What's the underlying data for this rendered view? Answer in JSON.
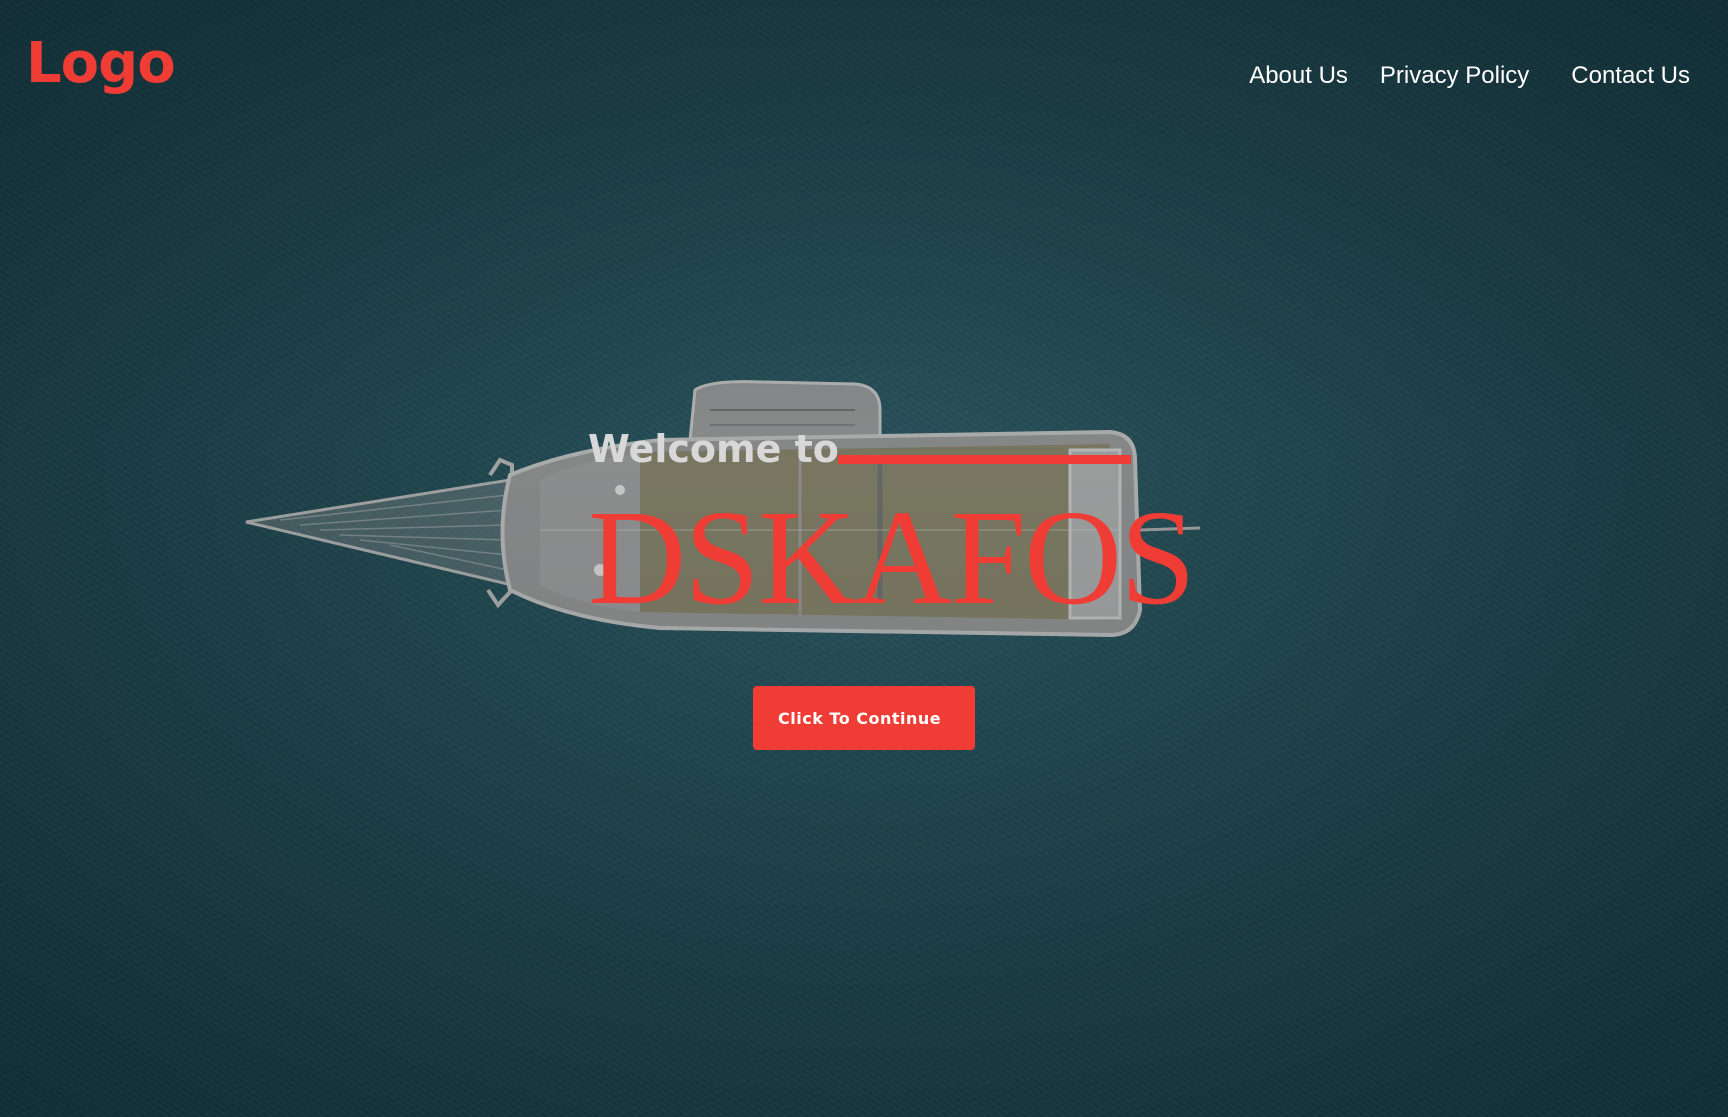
{
  "header": {
    "logo_text": "Logo",
    "nav": [
      {
        "label": "About Us"
      },
      {
        "label": "Privacy Policy"
      },
      {
        "label": "Contact Us"
      }
    ]
  },
  "hero": {
    "welcome_text": "Welcome to",
    "brand_name": "DSKAFOS",
    "cta_label": "Click To Continue"
  },
  "colors": {
    "accent": "#ef3d36",
    "text_light": "#ffffff",
    "welcome_gray": "#d8d8d8",
    "water": "#1f4650"
  }
}
